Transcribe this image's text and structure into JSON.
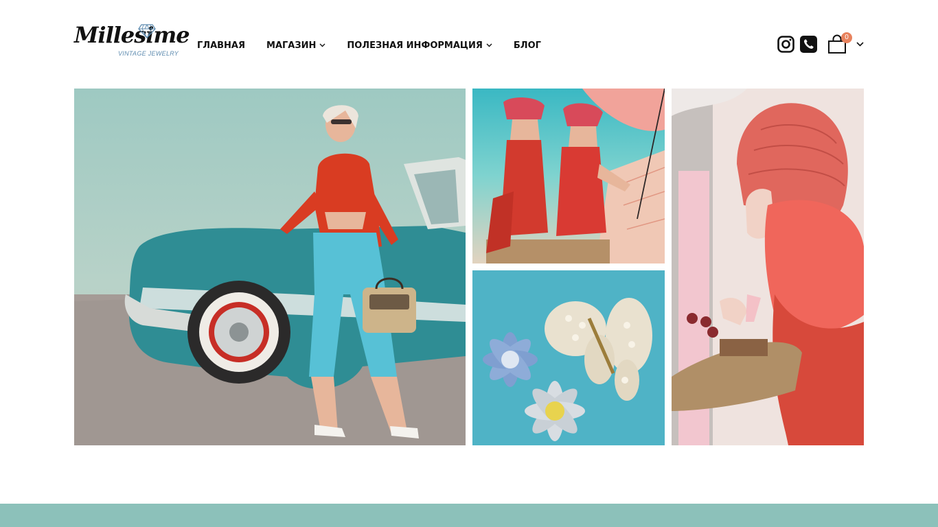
{
  "brand": {
    "name": "Millesime",
    "tagline": "VINTAGE JEWELRY",
    "accent": "#5f8cb0"
  },
  "nav": {
    "items": [
      {
        "label": "ГЛАВНАЯ",
        "dropdown": false
      },
      {
        "label": "МАГАЗИН",
        "dropdown": true
      },
      {
        "label": "ПОЛЕЗНАЯ ИНФОРМАЦИЯ",
        "dropdown": true
      },
      {
        "label": "БЛОГ",
        "dropdown": false
      }
    ]
  },
  "header_icons": {
    "instagram": "instagram-icon",
    "phone": "phone-icon",
    "cart": "shopping-bag-icon",
    "cart_count": "0",
    "cart_badge_color": "#e8825d"
  },
  "gallery": {
    "images": [
      "woman-with-turquoise-car-image",
      "women-in-red-swimsuits-image",
      "pearl-butterfly-brooches-image",
      "lady-in-red-hat-image"
    ]
  },
  "colors": {
    "footer": "#8cc1ba",
    "text": "#111111"
  }
}
